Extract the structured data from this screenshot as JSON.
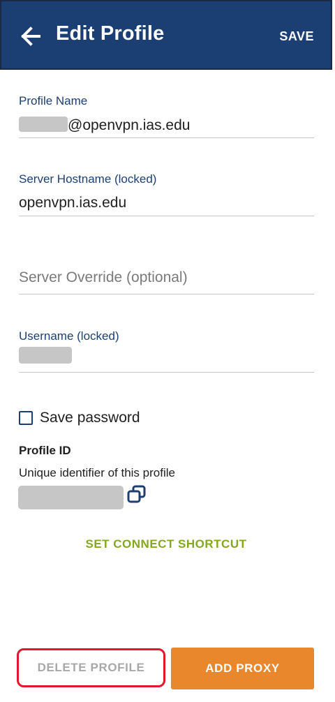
{
  "header": {
    "title": "Edit Profile",
    "save_label": "SAVE",
    "background": "#1c3f73"
  },
  "fields": {
    "profile_name": {
      "label": "Profile Name",
      "value_suffix": "@openvpn.ias.edu"
    },
    "server_hostname": {
      "label": "Server Hostname (locked)",
      "value": "openvpn.ias.edu"
    },
    "server_override": {
      "placeholder": "Server Override (optional)"
    },
    "username": {
      "label": "Username (locked)"
    }
  },
  "save_password": {
    "label": "Save password",
    "checked": false
  },
  "profile_id": {
    "title": "Profile ID",
    "description": "Unique identifier of this profile"
  },
  "actions": {
    "set_shortcut_label": "SET CONNECT SHORTCUT",
    "delete_label": "DELETE PROFILE",
    "add_proxy_label": "ADD PROXY"
  },
  "colors": {
    "accent_blue": "#1c3f73",
    "shortcut_green": "#84a81e",
    "proxy_orange": "#e9872d",
    "delete_highlight": "#e0182b"
  }
}
